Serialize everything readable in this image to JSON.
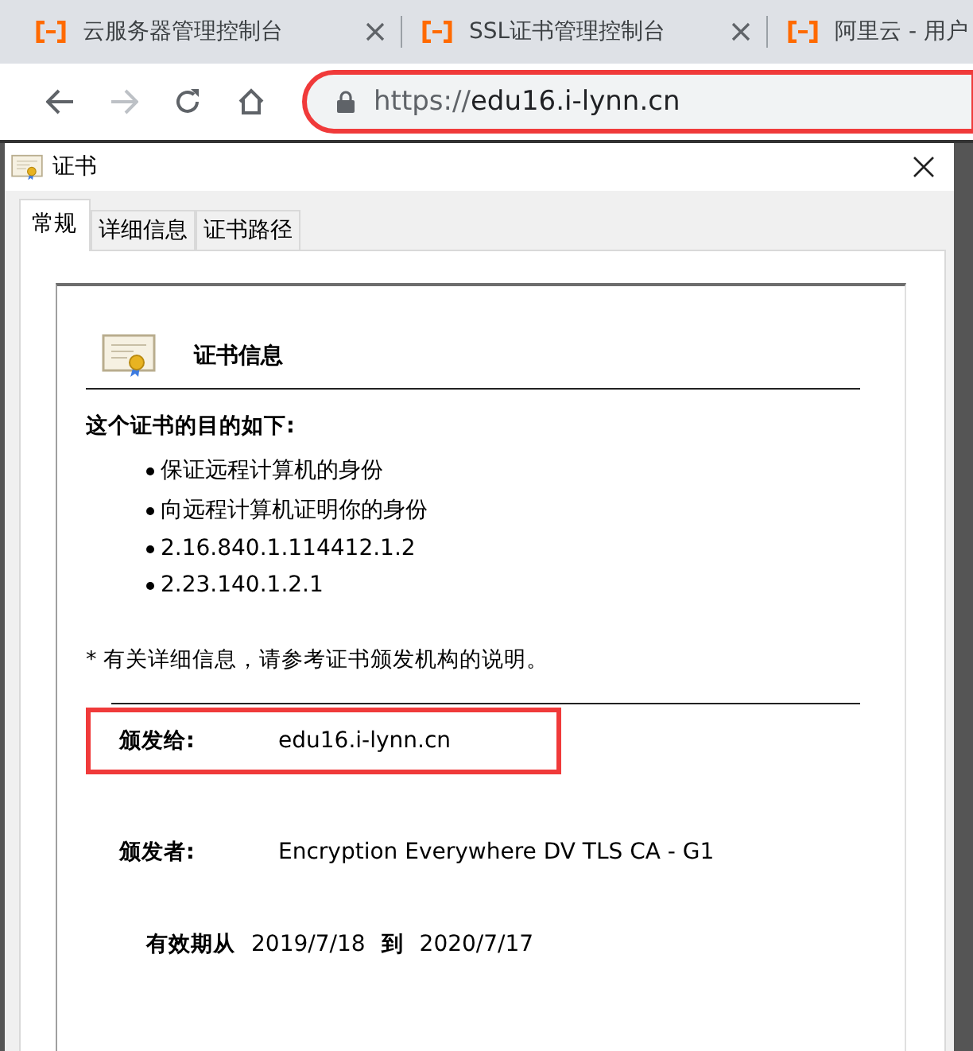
{
  "browser_tabs": [
    {
      "title": "云服务器管理控制台",
      "closable": true
    },
    {
      "title": "SSL证书管理控制台",
      "closable": true
    },
    {
      "title": "阿里云 - 用户",
      "closable": false
    }
  ],
  "address_bar": {
    "scheme": "https://",
    "host": "edu16.i-lynn.cn",
    "highlighted": true
  },
  "dialog": {
    "title": "证书",
    "tabs": [
      {
        "label": "常规",
        "selected": true
      },
      {
        "label": "详细信息",
        "selected": false
      },
      {
        "label": "证书路径",
        "selected": false
      }
    ],
    "heading": "证书信息",
    "purpose_label": "这个证书的目的如下:",
    "purposes": [
      "保证远程计算机的身份",
      "向远程计算机证明你的身份",
      "2.16.840.1.114412.1.2",
      "2.23.140.1.2.1"
    ],
    "note": "* 有关详细信息，请参考证书颁发机构的说明。",
    "fields": [
      {
        "label": "颁发给:",
        "value": "edu16.i-lynn.cn",
        "highlighted": true
      },
      {
        "label": "颁发者:",
        "value": "Encryption Everywhere DV TLS CA - G1",
        "highlighted": false
      }
    ],
    "validity": {
      "label": "有效期从",
      "from": "2019/7/18",
      "to_label": "到",
      "to": "2020/7/17"
    }
  }
}
